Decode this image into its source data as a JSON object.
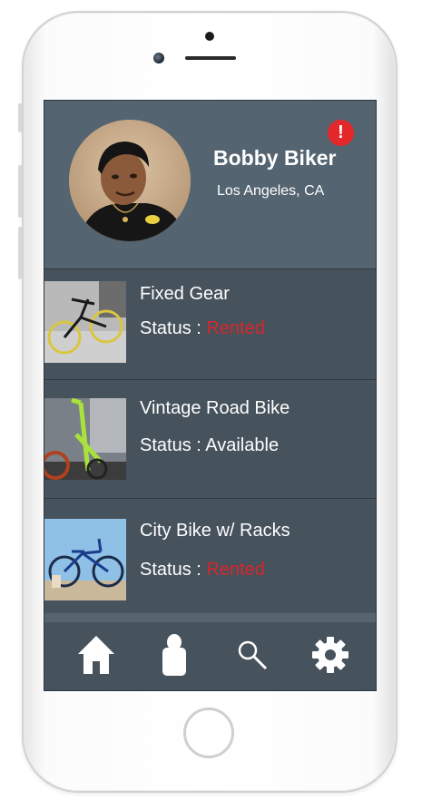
{
  "profile": {
    "name": "Bobby Biker",
    "location": "Los Angeles, CA",
    "alert_badge": "!"
  },
  "bikes": [
    {
      "title": "Fixed Gear",
      "status_label": "Status : ",
      "status_value": "Rented",
      "status_color": "#d8262b"
    },
    {
      "title": "Vintage Road Bike",
      "status_label": "Status : ",
      "status_value": "Available",
      "status_color": "#ffffff"
    },
    {
      "title": "City Bike w/ Racks",
      "status_label": "Status : ",
      "status_value": "Rented",
      "status_color": "#d8262b"
    }
  ],
  "tabbar": {
    "items": [
      "home-icon",
      "user-icon",
      "search-icon",
      "gear-icon"
    ]
  },
  "colors": {
    "screen_bg": "#4b5863",
    "profile_bg": "#546470",
    "alert": "#e3272a",
    "rented": "#d8262b"
  }
}
